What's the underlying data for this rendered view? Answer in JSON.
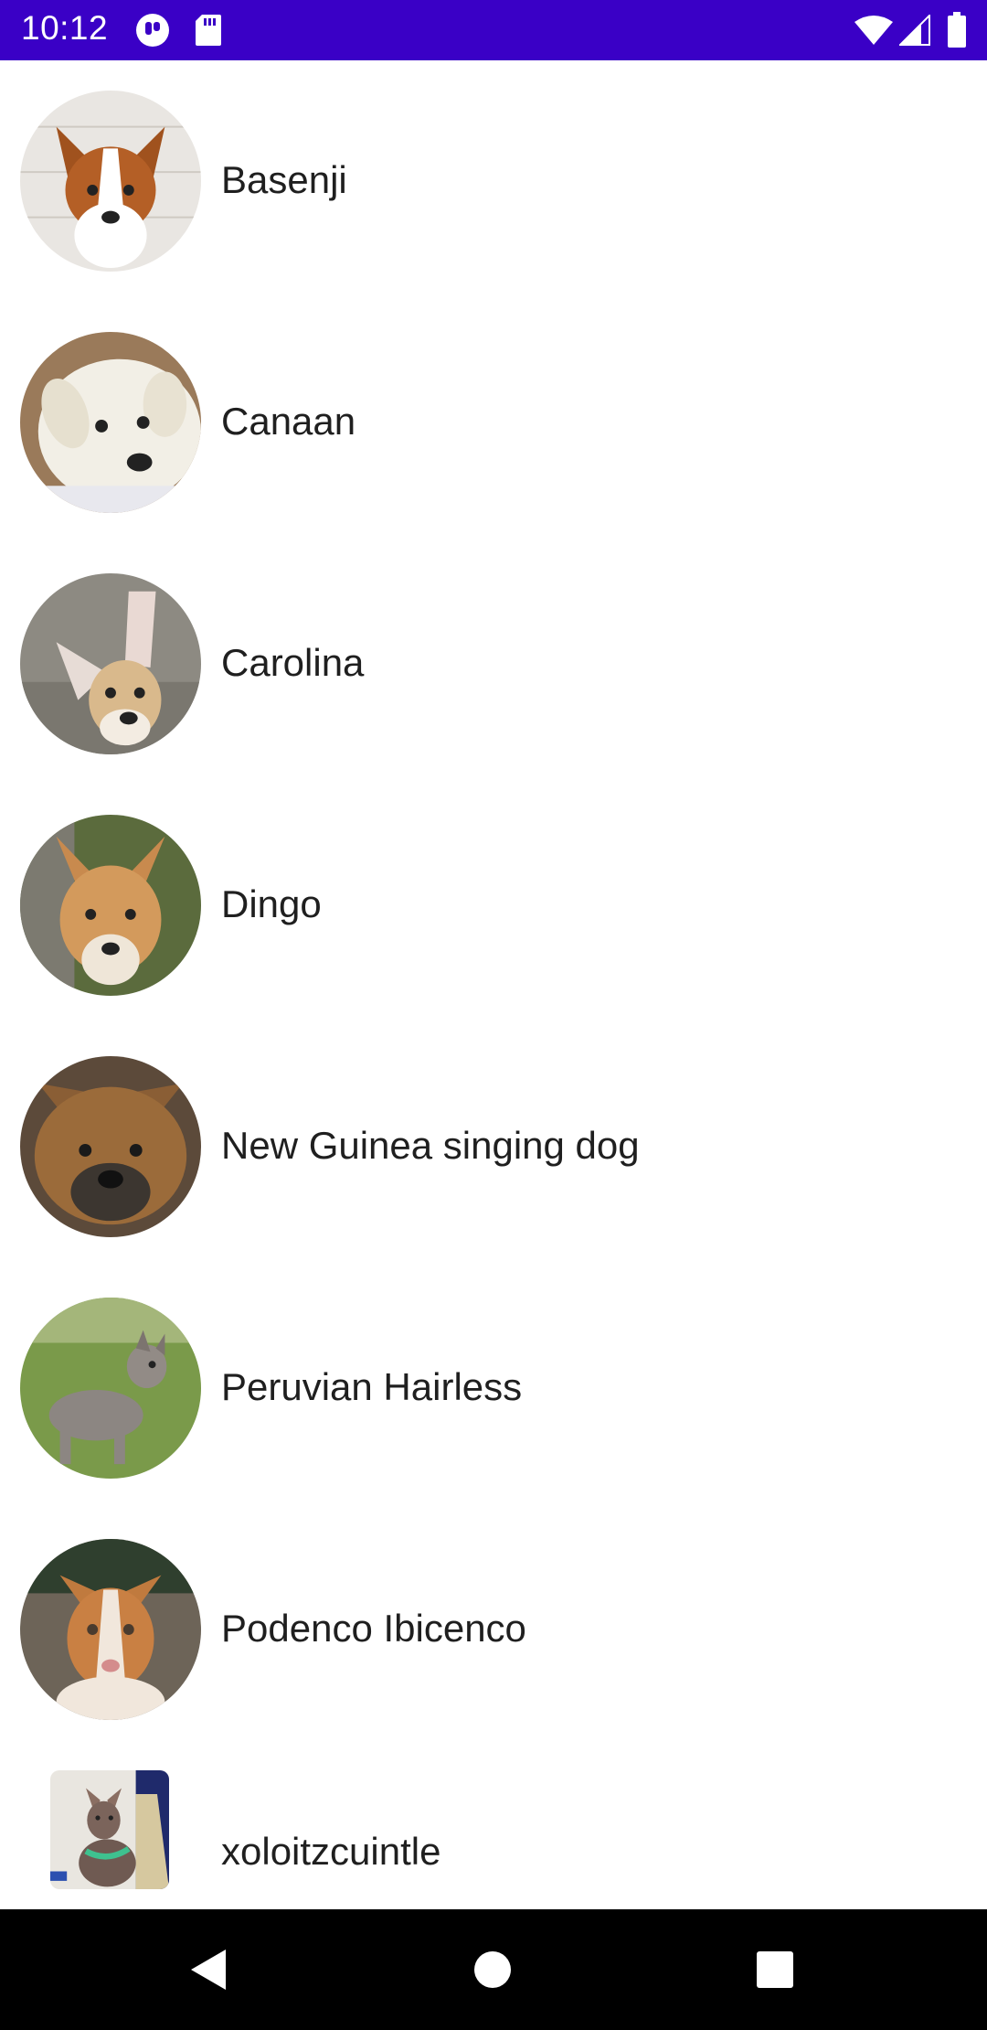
{
  "status_bar": {
    "time": "10:12",
    "background": "#3a00c6",
    "icons": [
      "notification-app-icon",
      "sd-card-icon",
      "wifi-icon",
      "signal-icon",
      "battery-icon"
    ]
  },
  "breeds": [
    {
      "name": "Basenji",
      "avatar": "basenji-photo"
    },
    {
      "name": "Canaan",
      "avatar": "canaan-photo"
    },
    {
      "name": "Carolina",
      "avatar": "carolina-photo"
    },
    {
      "name": "Dingo",
      "avatar": "dingo-photo"
    },
    {
      "name": "New Guinea singing dog",
      "avatar": "new-guinea-singing-dog-photo"
    },
    {
      "name": "Peruvian Hairless",
      "avatar": "peruvian-hairless-photo"
    },
    {
      "name": "Podenco Ibicenco",
      "avatar": "podenco-ibicenco-photo"
    },
    {
      "name": "xoloitzcuintle",
      "avatar": "xoloitzcuintle-photo"
    }
  ],
  "nav_bar": {
    "buttons": [
      "back-icon",
      "home-icon",
      "recents-icon"
    ]
  }
}
